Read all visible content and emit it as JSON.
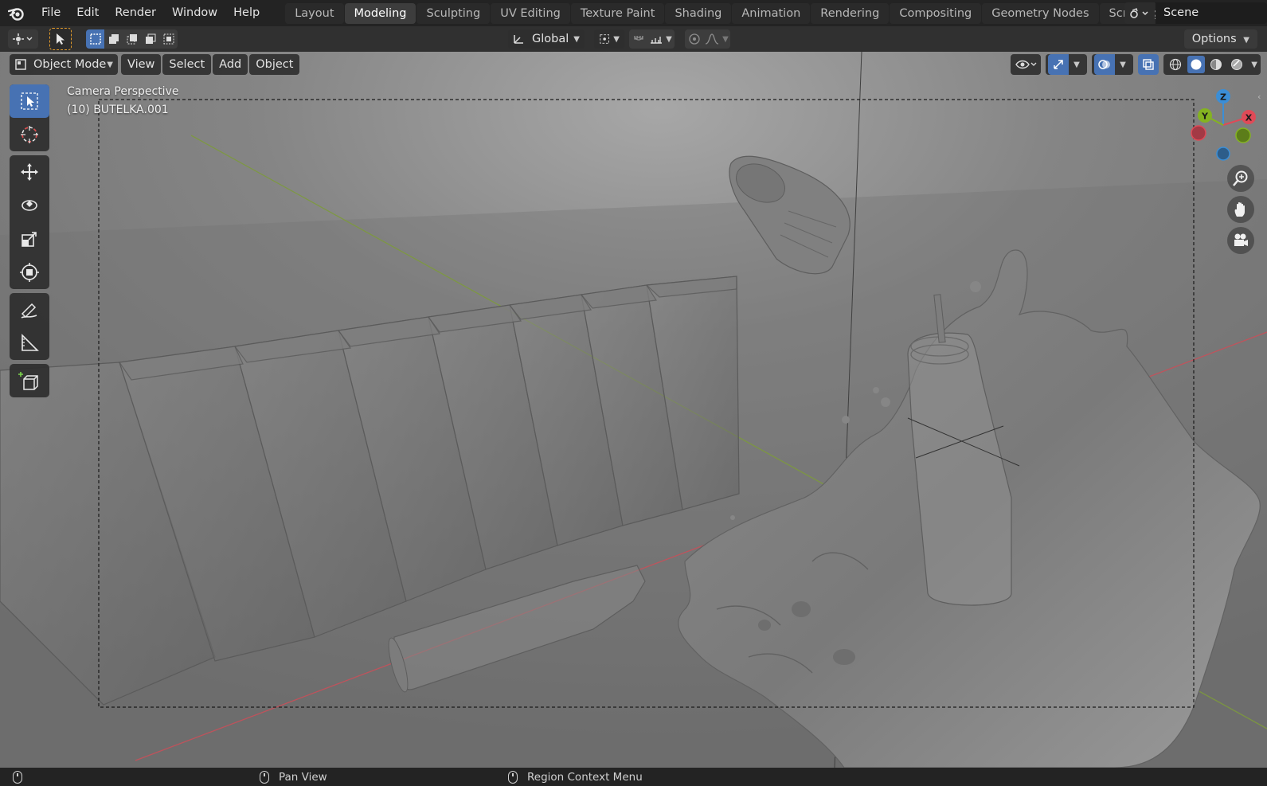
{
  "menu": {
    "items": [
      "File",
      "Edit",
      "Render",
      "Window",
      "Help"
    ]
  },
  "workspaces": {
    "tabs": [
      "Layout",
      "Modeling",
      "Sculpting",
      "UV Editing",
      "Texture Paint",
      "Shading",
      "Animation",
      "Rendering",
      "Compositing",
      "Geometry Nodes",
      "Scripting"
    ],
    "active": "Modeling"
  },
  "scene": {
    "name": "Scene"
  },
  "tool_header": {
    "transform_orientation": "Global",
    "options_label": "Options"
  },
  "viewport_header": {
    "mode": "Object Mode",
    "menus": [
      "View",
      "Select",
      "Add",
      "Object"
    ]
  },
  "viewport": {
    "view_name": "Camera Perspective",
    "active_object": "(10) BUTELKA.001",
    "gizmo_axes": [
      "X",
      "Y",
      "Z"
    ]
  },
  "status_bar": {
    "middle_hint": "Pan View",
    "right_hint": "Region Context Menu"
  },
  "colors": {
    "accent": "#4772b3",
    "axis_x": "#e04a57",
    "axis_y": "#84b320",
    "axis_z": "#3b8ed6"
  }
}
